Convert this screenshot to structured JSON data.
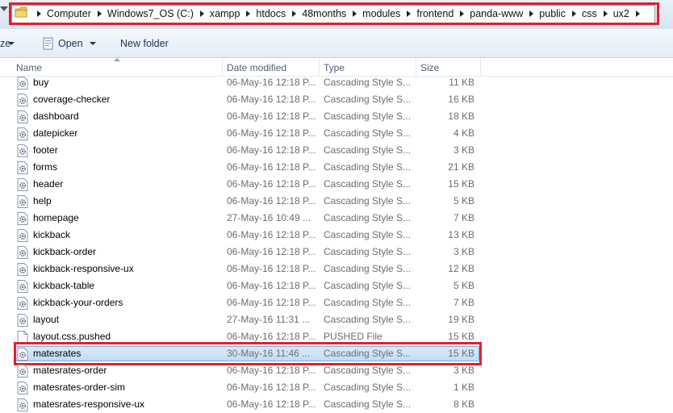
{
  "address": {
    "crumbs": [
      "Computer",
      "Windows7_OS (C:)",
      "xampp",
      "htdocs",
      "48months",
      "modules",
      "frontend",
      "panda-www",
      "public",
      "css",
      "ux2"
    ]
  },
  "toolbar": {
    "left_fragment": "ze",
    "open_label": "Open",
    "new_folder_label": "New folder"
  },
  "columns": {
    "name": "Name",
    "date": "Date modified",
    "type": "Type",
    "size": "Size"
  },
  "files": [
    {
      "name": "buy",
      "date": "06-May-16 12:18 P...",
      "type": "Cascading Style S...",
      "size": "11 KB",
      "icon": "css-gear-file-icon"
    },
    {
      "name": "coverage-checker",
      "date": "06-May-16 12:18 P...",
      "type": "Cascading Style S...",
      "size": "16 KB",
      "icon": "css-gear-file-icon"
    },
    {
      "name": "dashboard",
      "date": "06-May-16 12:18 P...",
      "type": "Cascading Style S...",
      "size": "18 KB",
      "icon": "css-gear-file-icon"
    },
    {
      "name": "datepicker",
      "date": "06-May-16 12:18 P...",
      "type": "Cascading Style S...",
      "size": "4 KB",
      "icon": "css-gear-file-icon"
    },
    {
      "name": "footer",
      "date": "06-May-16 12:18 P...",
      "type": "Cascading Style S...",
      "size": "3 KB",
      "icon": "css-gear-file-icon"
    },
    {
      "name": "forms",
      "date": "06-May-16 12:18 P...",
      "type": "Cascading Style S...",
      "size": "21 KB",
      "icon": "css-gear-file-icon"
    },
    {
      "name": "header",
      "date": "06-May-16 12:18 P...",
      "type": "Cascading Style S...",
      "size": "15 KB",
      "icon": "css-gear-file-icon"
    },
    {
      "name": "help",
      "date": "06-May-16 12:18 P...",
      "type": "Cascading Style S...",
      "size": "5 KB",
      "icon": "css-gear-file-icon"
    },
    {
      "name": "homepage",
      "date": "27-May-16 10:49 ...",
      "type": "Cascading Style S...",
      "size": "7 KB",
      "icon": "css-gear-file-icon"
    },
    {
      "name": "kickback",
      "date": "06-May-16 12:18 P...",
      "type": "Cascading Style S...",
      "size": "13 KB",
      "icon": "css-gear-file-icon"
    },
    {
      "name": "kickback-order",
      "date": "06-May-16 12:18 P...",
      "type": "Cascading Style S...",
      "size": "3 KB",
      "icon": "css-gear-file-icon"
    },
    {
      "name": "kickback-responsive-ux",
      "date": "06-May-16 12:18 P...",
      "type": "Cascading Style S...",
      "size": "12 KB",
      "icon": "css-gear-file-icon"
    },
    {
      "name": "kickback-table",
      "date": "06-May-16 12:18 P...",
      "type": "Cascading Style S...",
      "size": "5 KB",
      "icon": "css-gear-file-icon"
    },
    {
      "name": "kickback-your-orders",
      "date": "06-May-16 12:18 P...",
      "type": "Cascading Style S...",
      "size": "7 KB",
      "icon": "css-gear-file-icon"
    },
    {
      "name": "layout",
      "date": "27-May-16 11:31 ...",
      "type": "Cascading Style S...",
      "size": "19 KB",
      "icon": "css-gear-file-icon"
    },
    {
      "name": "layout.css.pushed",
      "date": "06-May-16 12:18 P...",
      "type": "PUSHED File",
      "size": "15 KB",
      "icon": "blank-file-icon"
    },
    {
      "name": "matesrates",
      "date": "30-May-16 11:46 ...",
      "type": "Cascading Style S...",
      "size": "15 KB",
      "icon": "css-gear-file-icon",
      "selected": true
    },
    {
      "name": "matesrates-order",
      "date": "06-May-16 12:18 P...",
      "type": "Cascading Style S...",
      "size": "3 KB",
      "icon": "css-gear-file-icon"
    },
    {
      "name": "matesrates-order-sim",
      "date": "06-May-16 12:18 P...",
      "type": "Cascading Style S...",
      "size": "1 KB",
      "icon": "css-gear-file-icon"
    },
    {
      "name": "matesrates-responsive-ux",
      "date": "06-May-16 12:18 P...",
      "type": "Cascading Style S...",
      "size": "8 KB",
      "icon": "css-gear-file-icon"
    }
  ],
  "colors": {
    "highlight_frame": "#e0202f",
    "selection_fill": "#c1dbfc",
    "selection_border": "#84acdd"
  }
}
